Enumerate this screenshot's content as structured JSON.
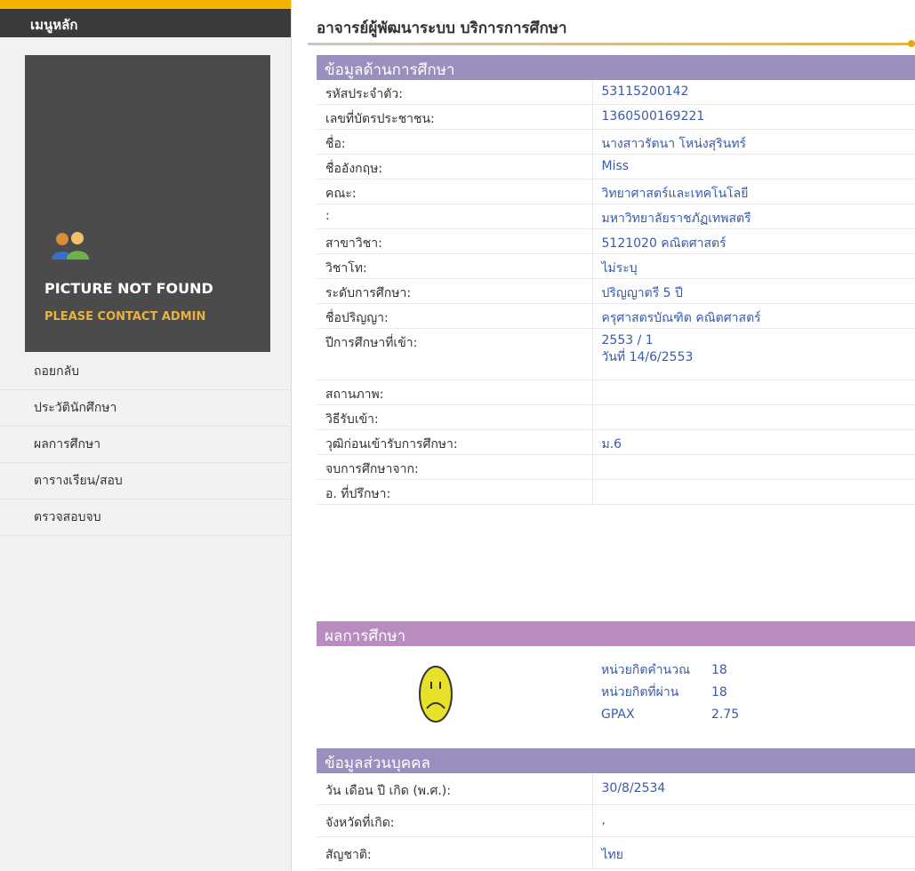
{
  "sidebar": {
    "menu_title": "เมนูหลัก",
    "photo": {
      "line1": "PICTURE NOT FOUND",
      "line2": "PLEASE CONTACT ADMIN",
      "icon": "people-icon"
    },
    "items": [
      {
        "label": "ถอยกลับ"
      },
      {
        "label": "ประวัตินักศึกษา"
      },
      {
        "label": "ผลการศึกษา"
      },
      {
        "label": "ตารางเรียน/สอบ"
      },
      {
        "label": "ตรวจสอบจบ"
      }
    ]
  },
  "main": {
    "title": "อาจารย์ผู้พัฒนาระบบ บริการการศึกษา",
    "education": {
      "heading": "ข้อมูลด้านการศึกษา",
      "rows": [
        {
          "label": "รหัสประจำตัว:",
          "value": "53115200142"
        },
        {
          "label": "เลขที่บัตรประชาชน:",
          "value": "1360500169221"
        },
        {
          "label": "ชื่อ:",
          "value": "นางสาวรัตนา โหน่งสุรินทร์"
        },
        {
          "label": "ชื่ออังกฤษ:",
          "value": "Miss"
        },
        {
          "label": "คณะ:",
          "value": "วิทยาศาสตร์และเทคโนโลยี"
        },
        {
          "label": ":",
          "value": "มหาวิทยาลัยราชภัฏเทพสตรี"
        },
        {
          "label": "สาขาวิชา:",
          "value": "5121020 คณิตศาสตร์"
        },
        {
          "label": "วิชาโท:",
          "value": "ไม่ระบุ"
        },
        {
          "label": "ระดับการศึกษา:",
          "value": "ปริญญาตรี 5 ปี"
        },
        {
          "label": "ชื่อปริญญา:",
          "value": "ครุศาสตรบัณฑิต คณิตศาสตร์"
        },
        {
          "label": "ปีการศึกษาที่เข้า:",
          "value": "2553 / 1",
          "value2": "วันที่ 14/6/2553"
        },
        {
          "label": "สถานภาพ:",
          "value": ""
        },
        {
          "label": "วิธีรับเข้า:",
          "value": ""
        },
        {
          "label": "วุฒิก่อนเข้ารับการศึกษา:",
          "value": "ม.6"
        },
        {
          "label": "จบการศึกษาจาก:",
          "value": ""
        },
        {
          "label": "อ. ที่ปรึกษา:",
          "value": ""
        }
      ]
    },
    "results": {
      "heading": "ผลการศึกษา",
      "face": "sad-face-icon",
      "stats": [
        {
          "key": "หน่วยกิตคำนวณ",
          "value": "18"
        },
        {
          "key": "หน่วยกิตที่ผ่าน",
          "value": "18"
        },
        {
          "key": "GPAX",
          "value": "2.75"
        }
      ]
    },
    "personal": {
      "heading": "ข้อมูลส่วนบุคคล",
      "rows": [
        {
          "label": "วัน เดือน ปี เกิด (พ.ศ.):",
          "value": "30/8/2534"
        },
        {
          "label": "จังหวัดที่เกิด:",
          "value": ","
        },
        {
          "label": "สัญชาติ:",
          "value": "ไทย"
        }
      ]
    }
  },
  "colors": {
    "section_purple": "#9a8fbf",
    "section_pink": "#b98bbf",
    "value_blue": "#3a5aa8",
    "top_strip": "#f3b400",
    "sidebar_dark": "#3a3a3a"
  }
}
